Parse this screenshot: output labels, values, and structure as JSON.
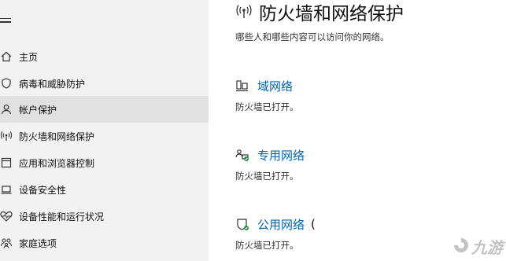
{
  "sidebar": {
    "items": [
      {
        "label": "主页",
        "icon": "home-icon"
      },
      {
        "label": "病毒和威胁防护",
        "icon": "shield-icon"
      },
      {
        "label": "帐户保护",
        "icon": "person-icon",
        "selected": true
      },
      {
        "label": "防火墙和网络保护",
        "icon": "wireless-icon"
      },
      {
        "label": "应用和浏览器控制",
        "icon": "app-window-icon"
      },
      {
        "label": "设备安全性",
        "icon": "laptop-icon"
      },
      {
        "label": "设备性能和运行状况",
        "icon": "heart-icon"
      },
      {
        "label": "家庭选项",
        "icon": "family-icon"
      }
    ]
  },
  "main": {
    "title": "防火墙和网络保护",
    "subtitle": "哪些人和哪些内容可以访问你的网络。",
    "networks": [
      {
        "name": "域网络",
        "status": "防火墙已打开。",
        "icon": "domain-network-icon"
      },
      {
        "name": "专用网络",
        "status": "防火墙已打开。",
        "icon": "private-network-icon"
      },
      {
        "name": "公用网络",
        "extra": "(",
        "status": "防火墙已打开。",
        "icon": "public-network-icon"
      }
    ]
  },
  "watermark": {
    "text": "九游"
  },
  "colors": {
    "accent": "#0063b1",
    "sidebar_bg": "#f2f2f2",
    "selected_bg": "#e1e1e1"
  }
}
